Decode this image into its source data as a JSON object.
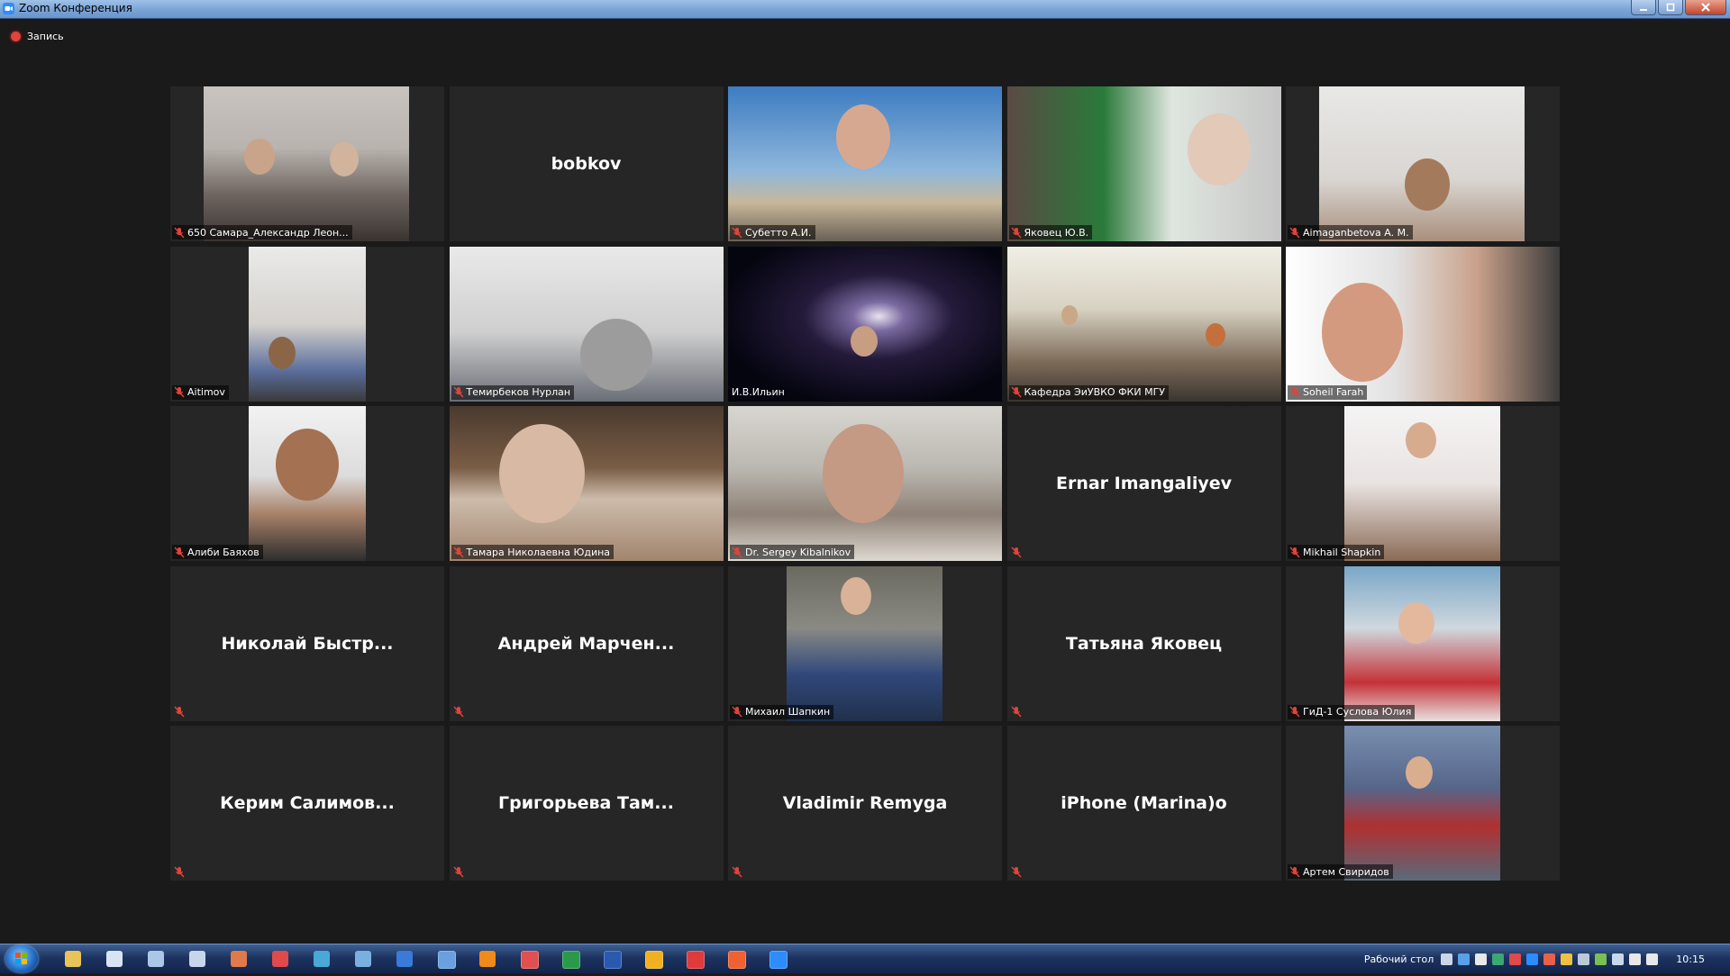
{
  "window": {
    "title": "Zoom Конференция"
  },
  "recording": {
    "label": "Запись"
  },
  "participants": [
    {
      "label": "650 Самара_Александр Леон..."
    },
    {
      "big_name": "bobkov"
    },
    {
      "label": "Субетто А.И."
    },
    {
      "label": "Яковец Ю.В."
    },
    {
      "label": "Aimaganbetova A. M."
    },
    {
      "label": "Aitimov"
    },
    {
      "label": "Темирбеков Нурлан"
    },
    {
      "label": "И.В.Ильин"
    },
    {
      "label": "Кафедра ЭиУВКО ФКИ МГУ"
    },
    {
      "label": "Soheil Farah"
    },
    {
      "label": "Алиби Баяхов"
    },
    {
      "label": "Тамара Николаевна Юдина"
    },
    {
      "label": "Dr. Sergey Kibalnikov"
    },
    {
      "big_name": "Ernar Imangaliyev"
    },
    {
      "label": "Mikhail Shapkin"
    },
    {
      "big_name": "Николай Быстр..."
    },
    {
      "big_name": "Андрей Марчен..."
    },
    {
      "label": "Михаил Шапкин"
    },
    {
      "big_name": "Татьяна Яковец"
    },
    {
      "label": "ГиД-1 Суслова Юлия"
    },
    {
      "big_name": "Керим Салимов..."
    },
    {
      "big_name": "Григорьева Там..."
    },
    {
      "big_name": "Vladimir Remyga"
    },
    {
      "big_name": "iPhone (Marina)o"
    },
    {
      "label": "Артем Свиридов"
    }
  ],
  "taskbar": {
    "desktop_label": "Рабочий стол",
    "clock": "10:15"
  },
  "colors": {
    "active_speaker_border": "#e3d34a",
    "muted_mic": "#e0443a",
    "tile_background": "#262626"
  }
}
